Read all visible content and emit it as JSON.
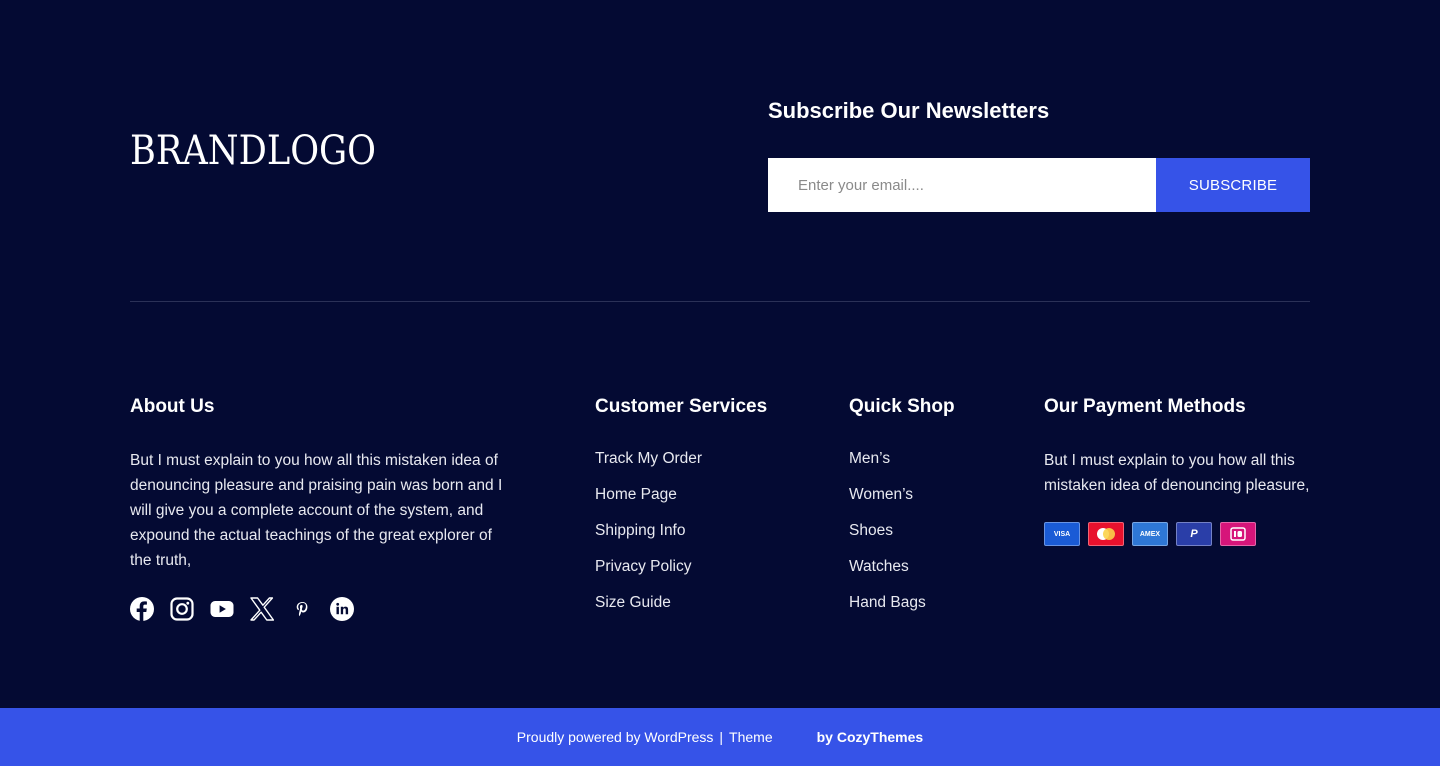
{
  "brand": {
    "logo_text": "BRANDLOGO"
  },
  "newsletter": {
    "title": "Subscribe Our Newsletters",
    "email_placeholder": "Enter your email....",
    "email_value": "",
    "subscribe_label": "SUBSCRIBE"
  },
  "about": {
    "title": "About Us",
    "text": "But I must explain to you how all this mistaken idea of denouncing pleasure and praising pain was born and I will give you a complete account of the system, and expound the actual teachings of the great explorer of the truth,",
    "socials": [
      "facebook-icon",
      "instagram-icon",
      "youtube-icon",
      "x-icon",
      "pinterest-icon",
      "linkedin-icon"
    ]
  },
  "services": {
    "title": "Customer Services",
    "links": [
      "Track My Order",
      "Home Page",
      "Shipping Info",
      "Privacy Policy",
      "Size Guide"
    ]
  },
  "shop": {
    "title": "Quick Shop",
    "links": [
      "Men’s",
      "Women’s",
      "Shoes",
      "Watches",
      "Hand Bags"
    ]
  },
  "payment": {
    "title": "Our Payment Methods",
    "text": "But I must explain to you how all this mistaken idea of denouncing pleasure,",
    "cards": [
      {
        "name": "visa-card",
        "label": "VISA",
        "color": "#1a5bd6"
      },
      {
        "name": "mastercard-card",
        "label": "",
        "color": "#e8112d"
      },
      {
        "name": "amex-card",
        "label": "AMEX",
        "color": "#2e77d6"
      },
      {
        "name": "paypal-card",
        "label": "P",
        "color": "#2a3ea8"
      },
      {
        "name": "ideal-card",
        "label": "",
        "color": "#d6157a"
      }
    ]
  },
  "footer": {
    "powered": "Proudly powered by WordPress",
    "separator": "|",
    "theme": "Theme",
    "by": "by CozyThemes"
  },
  "colors": {
    "background": "#040a33",
    "accent": "#3653e8"
  }
}
